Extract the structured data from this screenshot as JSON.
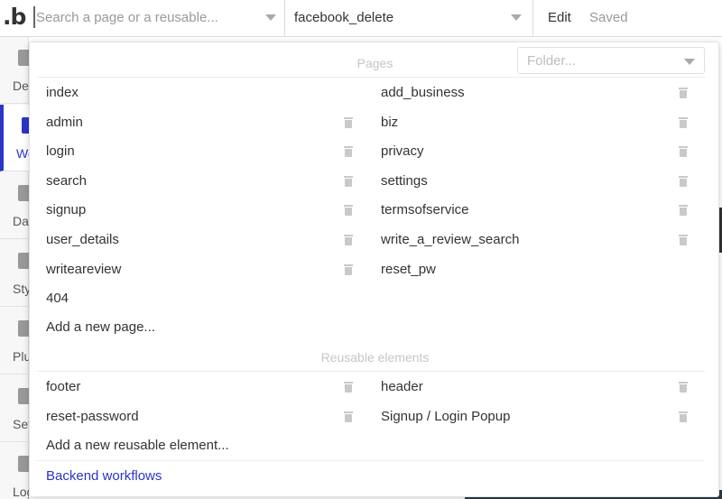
{
  "topbar": {
    "logo": ".b",
    "search_placeholder": "Search a page or a reusable...",
    "current_page": "facebook_delete",
    "edit_label": "Edit",
    "saved_label": "Saved"
  },
  "sidebar": {
    "items": [
      {
        "label": "Design",
        "icon": "design-icon"
      },
      {
        "label": "Workflow",
        "icon": "workflow-icon",
        "active": true
      },
      {
        "label": "Data",
        "icon": "data-icon"
      },
      {
        "label": "Styles",
        "icon": "styles-icon"
      },
      {
        "label": "Plugins",
        "icon": "plugins-icon"
      },
      {
        "label": "Settings",
        "icon": "settings-icon"
      },
      {
        "label": "Logs",
        "icon": "logs-icon"
      }
    ]
  },
  "dropdown": {
    "folder_placeholder": "Folder...",
    "pages_title": "Pages",
    "pages_left": [
      "index",
      "admin",
      "login",
      "search",
      "signup",
      "user_details",
      "writeareview",
      "404"
    ],
    "pages_right": [
      "add_business",
      "biz",
      "privacy",
      "settings",
      "termsofservice",
      "write_a_review_search",
      "reset_pw"
    ],
    "add_page": "Add a new page...",
    "reusable_title": "Reusable elements",
    "reusable_left": [
      "footer",
      "reset-password"
    ],
    "reusable_right": [
      "header",
      "Signup / Login Popup"
    ],
    "add_reusable": "Add a new reusable element...",
    "backend_workflows": "Backend workflows"
  },
  "colors": {
    "accent": "#2a35c9",
    "muted_text": "#999999",
    "section_title": "#c6c6c6"
  }
}
